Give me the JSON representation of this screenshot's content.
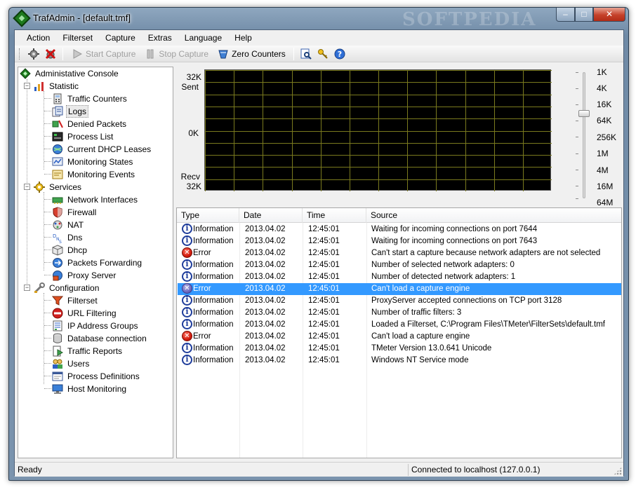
{
  "window": {
    "title": "TrafAdmin - [default.tmf]",
    "watermark": "SOFTPEDIA",
    "controls": {
      "minimize": "–",
      "maximize": "□",
      "close": "✕"
    }
  },
  "menu": [
    "Action",
    "Filterset",
    "Capture",
    "Extras",
    "Language",
    "Help"
  ],
  "toolbar": {
    "start_capture": "Start Capture",
    "stop_capture": "Stop Capture",
    "zero_counters": "Zero Counters",
    "icons": [
      "settings-icon",
      "disconnect-icon",
      "play-icon",
      "stop-icon",
      "zero-counters-icon",
      "find-icon",
      "keys-icon",
      "help-icon"
    ]
  },
  "tree": {
    "root": "Administative Console",
    "statistic": {
      "label": "Statistic",
      "items": [
        "Traffic Counters",
        "Logs",
        "Denied Packets",
        "Process List",
        "Current DHCP Leases",
        "Monitoring States",
        "Monitoring Events"
      ]
    },
    "services": {
      "label": "Services",
      "items": [
        "Network Interfaces",
        "Firewall",
        "NAT",
        "Dns",
        "Dhcp",
        "Packets Forwarding",
        "Proxy Server"
      ]
    },
    "configuration": {
      "label": "Configuration",
      "items": [
        "Filterset",
        "URL Filtering",
        "IP Address Groups",
        "Database connection",
        "Traffic Reports",
        "Users",
        "Process Definitions",
        "Host Monitoring"
      ]
    },
    "selected": "Logs"
  },
  "graph": {
    "sent_value": "32K",
    "sent_label": "Sent",
    "zero_label": "0K",
    "recv_label": "Recv",
    "recv_value": "32K",
    "scale": [
      "1K",
      "4K",
      "16K",
      "64K",
      "256K",
      "1M",
      "4M",
      "16M",
      "64M"
    ],
    "selected_scale": "64K",
    "grid_color": "#7a7a1e",
    "background": "#000000"
  },
  "log": {
    "columns": [
      "Type",
      "Date",
      "Time",
      "Source"
    ],
    "rows": [
      {
        "icon": "info-icon",
        "type": "Information",
        "date": "2013.04.02",
        "time": "12:45:01",
        "source": "Waiting for incoming connections on port 7644"
      },
      {
        "icon": "info-icon",
        "type": "Information",
        "date": "2013.04.02",
        "time": "12:45:01",
        "source": "Waiting for incoming connections on port 7643"
      },
      {
        "icon": "error-icon",
        "type": "Error",
        "date": "2013.04.02",
        "time": "12:45:01",
        "source": "Can't start a capture because network adapters are not selected"
      },
      {
        "icon": "info-icon",
        "type": "Information",
        "date": "2013.04.02",
        "time": "12:45:01",
        "source": "Number of selected network adapters: 0"
      },
      {
        "icon": "info-icon",
        "type": "Information",
        "date": "2013.04.02",
        "time": "12:45:01",
        "source": "Number of detected network adapters: 1"
      },
      {
        "icon": "error-icon",
        "type": "Error",
        "date": "2013.04.02",
        "time": "12:45:01",
        "source": "Can't load a capture engine",
        "selected": true
      },
      {
        "icon": "info-icon",
        "type": "Information",
        "date": "2013.04.02",
        "time": "12:45:01",
        "source": "ProxyServer accepted connections on TCP port 3128"
      },
      {
        "icon": "info-icon",
        "type": "Information",
        "date": "2013.04.02",
        "time": "12:45:01",
        "source": "Number of traffic filters: 3"
      },
      {
        "icon": "info-icon",
        "type": "Information",
        "date": "2013.04.02",
        "time": "12:45:01",
        "source": "Loaded a Filterset, C:\\Program Files\\TMeter\\FilterSets\\default.tmf"
      },
      {
        "icon": "error-icon",
        "type": "Error",
        "date": "2013.04.02",
        "time": "12:45:01",
        "source": "Can't load a capture engine"
      },
      {
        "icon": "info-icon",
        "type": "Information",
        "date": "2013.04.02",
        "time": "12:45:01",
        "source": "TMeter Version 13.0.641 Unicode"
      },
      {
        "icon": "info-icon",
        "type": "Information",
        "date": "2013.04.02",
        "time": "12:45:01",
        "source": "Windows NT Service mode"
      }
    ]
  },
  "status": {
    "left": "Ready",
    "right": "Connected to localhost (127.0.0.1)"
  }
}
